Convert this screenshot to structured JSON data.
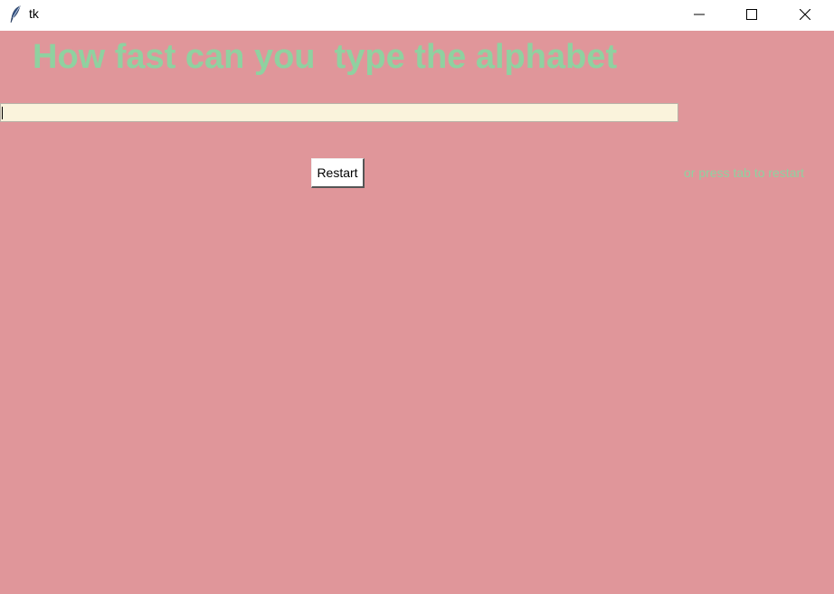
{
  "window": {
    "title": "tk",
    "icon": "tk-feather-icon",
    "controls": [
      "minimize-icon",
      "maximize-icon",
      "close-icon"
    ]
  },
  "main": {
    "heading": "How fast can you  type the alphabet",
    "entry_value": "",
    "restart_label": "Restart",
    "hint": "or press tab to restart"
  },
  "colors": {
    "background": "#e0969a",
    "heading": "#8fd1a0",
    "hint": "#8fd1a0",
    "entry_background": "#faf3dc",
    "button_background": "#ffffff"
  }
}
